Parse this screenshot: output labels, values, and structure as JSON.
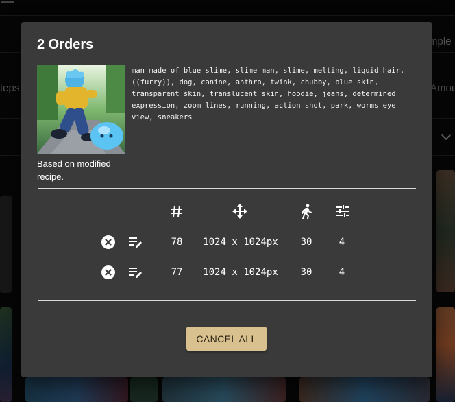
{
  "background": {
    "label_sampler": "mple",
    "label_steps": "teps",
    "label_amount": "Amou"
  },
  "dialog": {
    "title": "2 Orders",
    "prompt": "man made of blue slime, slime man, slime, melting, liquid hair, ((furry)), dog, canine, anthro, twink, chubby, blue skin, transparent skin, translucent skin, hoodie, jeans, determined expression, zoom lines, running, action shot, park, worms eye view, sneakers",
    "recipe_note": "Based on modified recipe.",
    "columns": {
      "count_icon": "hash-icon",
      "size_icon": "move-arrows-icon",
      "steps_icon": "running-person-icon",
      "settings_icon": "tune-sliders-icon"
    },
    "orders": [
      {
        "count": "78",
        "size": "1024 x 1024px",
        "steps": "30",
        "settings": "4"
      },
      {
        "count": "77",
        "size": "1024 x 1024px",
        "steps": "30",
        "settings": "4"
      }
    ],
    "cancel_all_label": "CANCEL ALL"
  },
  "colors": {
    "dialog_bg": "#3a3a3a",
    "button_bg": "#d8c08f",
    "page_bg": "#0c0c0c"
  }
}
